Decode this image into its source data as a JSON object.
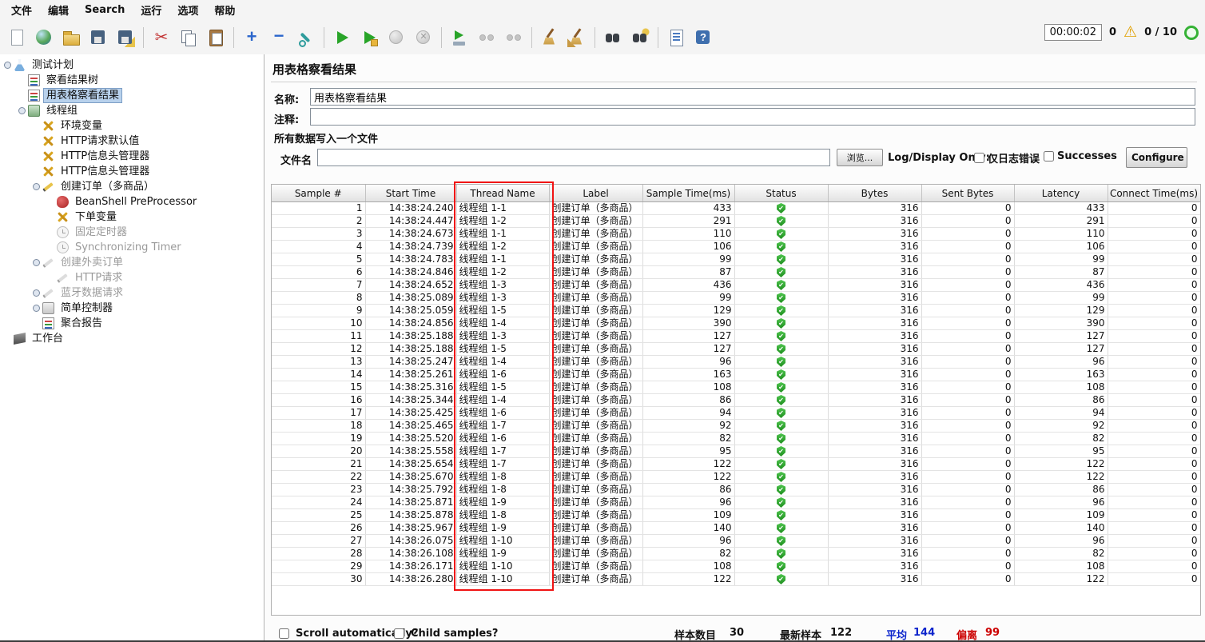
{
  "menubar": {
    "items": [
      "文件",
      "编辑",
      "Search",
      "运行",
      "选项",
      "帮助"
    ]
  },
  "toolbar": {
    "items": [
      {
        "name": "new-plan-icon"
      },
      {
        "name": "templates-icon"
      },
      {
        "name": "open-file-icon"
      },
      {
        "name": "save-icon"
      },
      {
        "name": "save-as-icon"
      },
      {
        "separator": true
      },
      {
        "name": "cut-icon"
      },
      {
        "name": "copy-icon"
      },
      {
        "name": "paste-icon"
      },
      {
        "separator": true
      },
      {
        "name": "expand-all-icon"
      },
      {
        "name": "collapse-all-icon"
      },
      {
        "name": "toggle-icon"
      },
      {
        "separator": true
      },
      {
        "name": "start-icon"
      },
      {
        "name": "start-no-timers-icon"
      },
      {
        "name": "stop-icon",
        "disabled": true
      },
      {
        "name": "shutdown-icon",
        "disabled": true
      },
      {
        "separator": true
      },
      {
        "name": "remote-start-icon"
      },
      {
        "name": "remote-start-all-icon",
        "disabled": true
      },
      {
        "name": "remote-stop-icon",
        "disabled": true
      },
      {
        "separator": true
      },
      {
        "name": "clear-icon"
      },
      {
        "name": "clear-all-icon"
      },
      {
        "separator": true
      },
      {
        "name": "search-icon"
      },
      {
        "name": "search-reset-icon"
      },
      {
        "separator": true
      },
      {
        "name": "function-helper-icon"
      },
      {
        "name": "help-icon"
      }
    ]
  },
  "status": {
    "timer": "00:00:02",
    "error_count": "0",
    "thread_counts": "0 / 10"
  },
  "tree": {
    "items": [
      {
        "level": 0,
        "icon": "beaker-icon",
        "label": "测试计划",
        "handle": true
      },
      {
        "level": 1,
        "icon": "chart-icon",
        "label": "察看结果树"
      },
      {
        "level": 1,
        "icon": "chart-icon",
        "label": "用表格察看结果",
        "selected": true
      },
      {
        "level": 1,
        "icon": "thread-group-icon",
        "label": "线程组",
        "handle": true
      },
      {
        "level": 2,
        "icon": "wrench-icon",
        "label": "环境变量"
      },
      {
        "level": 2,
        "icon": "wrench-icon",
        "label": "HTTP请求默认值"
      },
      {
        "level": 2,
        "icon": "wrench-icon",
        "label": "HTTP信息头管理器"
      },
      {
        "level": 2,
        "icon": "wrench-icon",
        "label": "HTTP信息头管理器"
      },
      {
        "level": 2,
        "icon": "pencil-icon",
        "label": "创建订单（多商品）",
        "handle": true
      },
      {
        "level": 3,
        "icon": "beanshell-icon",
        "label": "BeanShell PreProcessor"
      },
      {
        "level": 3,
        "icon": "wrench-icon",
        "label": "下单变量"
      },
      {
        "level": 3,
        "icon": "clock-icon",
        "label": "固定定时器",
        "disabled": true
      },
      {
        "level": 3,
        "icon": "clock-icon",
        "label": "Synchronizing Timer",
        "disabled": true
      },
      {
        "level": 2,
        "icon": "pencil-icon",
        "label": "创建外卖订单",
        "handle": true,
        "disabled": true
      },
      {
        "level": 3,
        "icon": "pencil-icon",
        "label": "HTTP请求",
        "disabled": true
      },
      {
        "level": 2,
        "icon": "pencil-icon",
        "label": "蓝牙数据请求",
        "handle": true,
        "disabled": true
      },
      {
        "level": 2,
        "icon": "controller-icon",
        "label": "简单控制器",
        "handle": true
      },
      {
        "level": 2,
        "icon": "report-icon",
        "label": "聚合报告"
      },
      {
        "level": 0,
        "icon": "workbench-icon",
        "label": "工作台"
      }
    ]
  },
  "panel": {
    "title": "用表格察看结果",
    "name_label": "名称:",
    "name_value": "用表格察看结果",
    "comment_label": "注释:",
    "comment_value": "",
    "file_section_title": "所有数据写入一个文件",
    "filename_label": "文件名",
    "filename_value": "",
    "browse_button": "浏览...",
    "log_display_label": "Log/Display Only:",
    "errors_only_label": "仅日志错误",
    "successes_label": "Successes",
    "configure_button": "Configure"
  },
  "table": {
    "columns": [
      "Sample #",
      "Start Time",
      "Thread Name",
      "Label",
      "Sample Time(ms)",
      "Status",
      "Bytes",
      "Sent Bytes",
      "Latency",
      "Connect Time(ms)"
    ],
    "rows": [
      [
        "1",
        "14:38:24.240",
        "线程组 1-1",
        "创建订单（多商品）",
        "433",
        "success",
        "316",
        "0",
        "433",
        "0"
      ],
      [
        "2",
        "14:38:24.447",
        "线程组 1-2",
        "创建订单（多商品）",
        "291",
        "success",
        "316",
        "0",
        "291",
        "0"
      ],
      [
        "3",
        "14:38:24.673",
        "线程组 1-1",
        "创建订单（多商品）",
        "110",
        "success",
        "316",
        "0",
        "110",
        "0"
      ],
      [
        "4",
        "14:38:24.739",
        "线程组 1-2",
        "创建订单（多商品）",
        "106",
        "success",
        "316",
        "0",
        "106",
        "0"
      ],
      [
        "5",
        "14:38:24.783",
        "线程组 1-1",
        "创建订单（多商品）",
        "99",
        "success",
        "316",
        "0",
        "99",
        "0"
      ],
      [
        "6",
        "14:38:24.846",
        "线程组 1-2",
        "创建订单（多商品）",
        "87",
        "success",
        "316",
        "0",
        "87",
        "0"
      ],
      [
        "7",
        "14:38:24.652",
        "线程组 1-3",
        "创建订单（多商品）",
        "436",
        "success",
        "316",
        "0",
        "436",
        "0"
      ],
      [
        "8",
        "14:38:25.089",
        "线程组 1-3",
        "创建订单（多商品）",
        "99",
        "success",
        "316",
        "0",
        "99",
        "0"
      ],
      [
        "9",
        "14:38:25.059",
        "线程组 1-5",
        "创建订单（多商品）",
        "129",
        "success",
        "316",
        "0",
        "129",
        "0"
      ],
      [
        "10",
        "14:38:24.856",
        "线程组 1-4",
        "创建订单（多商品）",
        "390",
        "success",
        "316",
        "0",
        "390",
        "0"
      ],
      [
        "11",
        "14:38:25.188",
        "线程组 1-3",
        "创建订单（多商品）",
        "127",
        "success",
        "316",
        "0",
        "127",
        "0"
      ],
      [
        "12",
        "14:38:25.188",
        "线程组 1-5",
        "创建订单（多商品）",
        "127",
        "success",
        "316",
        "0",
        "127",
        "0"
      ],
      [
        "13",
        "14:38:25.247",
        "线程组 1-4",
        "创建订单（多商品）",
        "96",
        "success",
        "316",
        "0",
        "96",
        "0"
      ],
      [
        "14",
        "14:38:25.261",
        "线程组 1-6",
        "创建订单（多商品）",
        "163",
        "success",
        "316",
        "0",
        "163",
        "0"
      ],
      [
        "15",
        "14:38:25.316",
        "线程组 1-5",
        "创建订单（多商品）",
        "108",
        "success",
        "316",
        "0",
        "108",
        "0"
      ],
      [
        "16",
        "14:38:25.344",
        "线程组 1-4",
        "创建订单（多商品）",
        "86",
        "success",
        "316",
        "0",
        "86",
        "0"
      ],
      [
        "17",
        "14:38:25.425",
        "线程组 1-6",
        "创建订单（多商品）",
        "94",
        "success",
        "316",
        "0",
        "94",
        "0"
      ],
      [
        "18",
        "14:38:25.465",
        "线程组 1-7",
        "创建订单（多商品）",
        "92",
        "success",
        "316",
        "0",
        "92",
        "0"
      ],
      [
        "19",
        "14:38:25.520",
        "线程组 1-6",
        "创建订单（多商品）",
        "82",
        "success",
        "316",
        "0",
        "82",
        "0"
      ],
      [
        "20",
        "14:38:25.558",
        "线程组 1-7",
        "创建订单（多商品）",
        "95",
        "success",
        "316",
        "0",
        "95",
        "0"
      ],
      [
        "21",
        "14:38:25.654",
        "线程组 1-7",
        "创建订单（多商品）",
        "122",
        "success",
        "316",
        "0",
        "122",
        "0"
      ],
      [
        "22",
        "14:38:25.670",
        "线程组 1-8",
        "创建订单（多商品）",
        "122",
        "success",
        "316",
        "0",
        "122",
        "0"
      ],
      [
        "23",
        "14:38:25.792",
        "线程组 1-8",
        "创建订单（多商品）",
        "86",
        "success",
        "316",
        "0",
        "86",
        "0"
      ],
      [
        "24",
        "14:38:25.871",
        "线程组 1-9",
        "创建订单（多商品）",
        "96",
        "success",
        "316",
        "0",
        "96",
        "0"
      ],
      [
        "25",
        "14:38:25.878",
        "线程组 1-8",
        "创建订单（多商品）",
        "109",
        "success",
        "316",
        "0",
        "109",
        "0"
      ],
      [
        "26",
        "14:38:25.967",
        "线程组 1-9",
        "创建订单（多商品）",
        "140",
        "success",
        "316",
        "0",
        "140",
        "0"
      ],
      [
        "27",
        "14:38:26.075",
        "线程组 1-10",
        "创建订单（多商品）",
        "96",
        "success",
        "316",
        "0",
        "96",
        "0"
      ],
      [
        "28",
        "14:38:26.108",
        "线程组 1-9",
        "创建订单（多商品）",
        "82",
        "success",
        "316",
        "0",
        "82",
        "0"
      ],
      [
        "29",
        "14:38:26.171",
        "线程组 1-10",
        "创建订单（多商品）",
        "108",
        "success",
        "316",
        "0",
        "108",
        "0"
      ],
      [
        "30",
        "14:38:26.280",
        "线程组 1-10",
        "创建订单（多商品）",
        "122",
        "success",
        "316",
        "0",
        "122",
        "0"
      ]
    ],
    "status_success_color": "#2faf2f"
  },
  "annotation": {
    "type": "highlight-box",
    "target_column": "Thread Name",
    "color": "#f01414"
  },
  "footer": {
    "scroll_label": "Scroll automatically?",
    "child_label": "Child samples?",
    "sample_count_label": "样本数目",
    "sample_count_value": "30",
    "latest_label": "最新样本",
    "latest_value": "122",
    "average_label": "平均",
    "average_value": "144",
    "average_color": "#0b24cc",
    "deviation_label": "偏离",
    "deviation_value": "99",
    "deviation_color": "#cc0000"
  }
}
